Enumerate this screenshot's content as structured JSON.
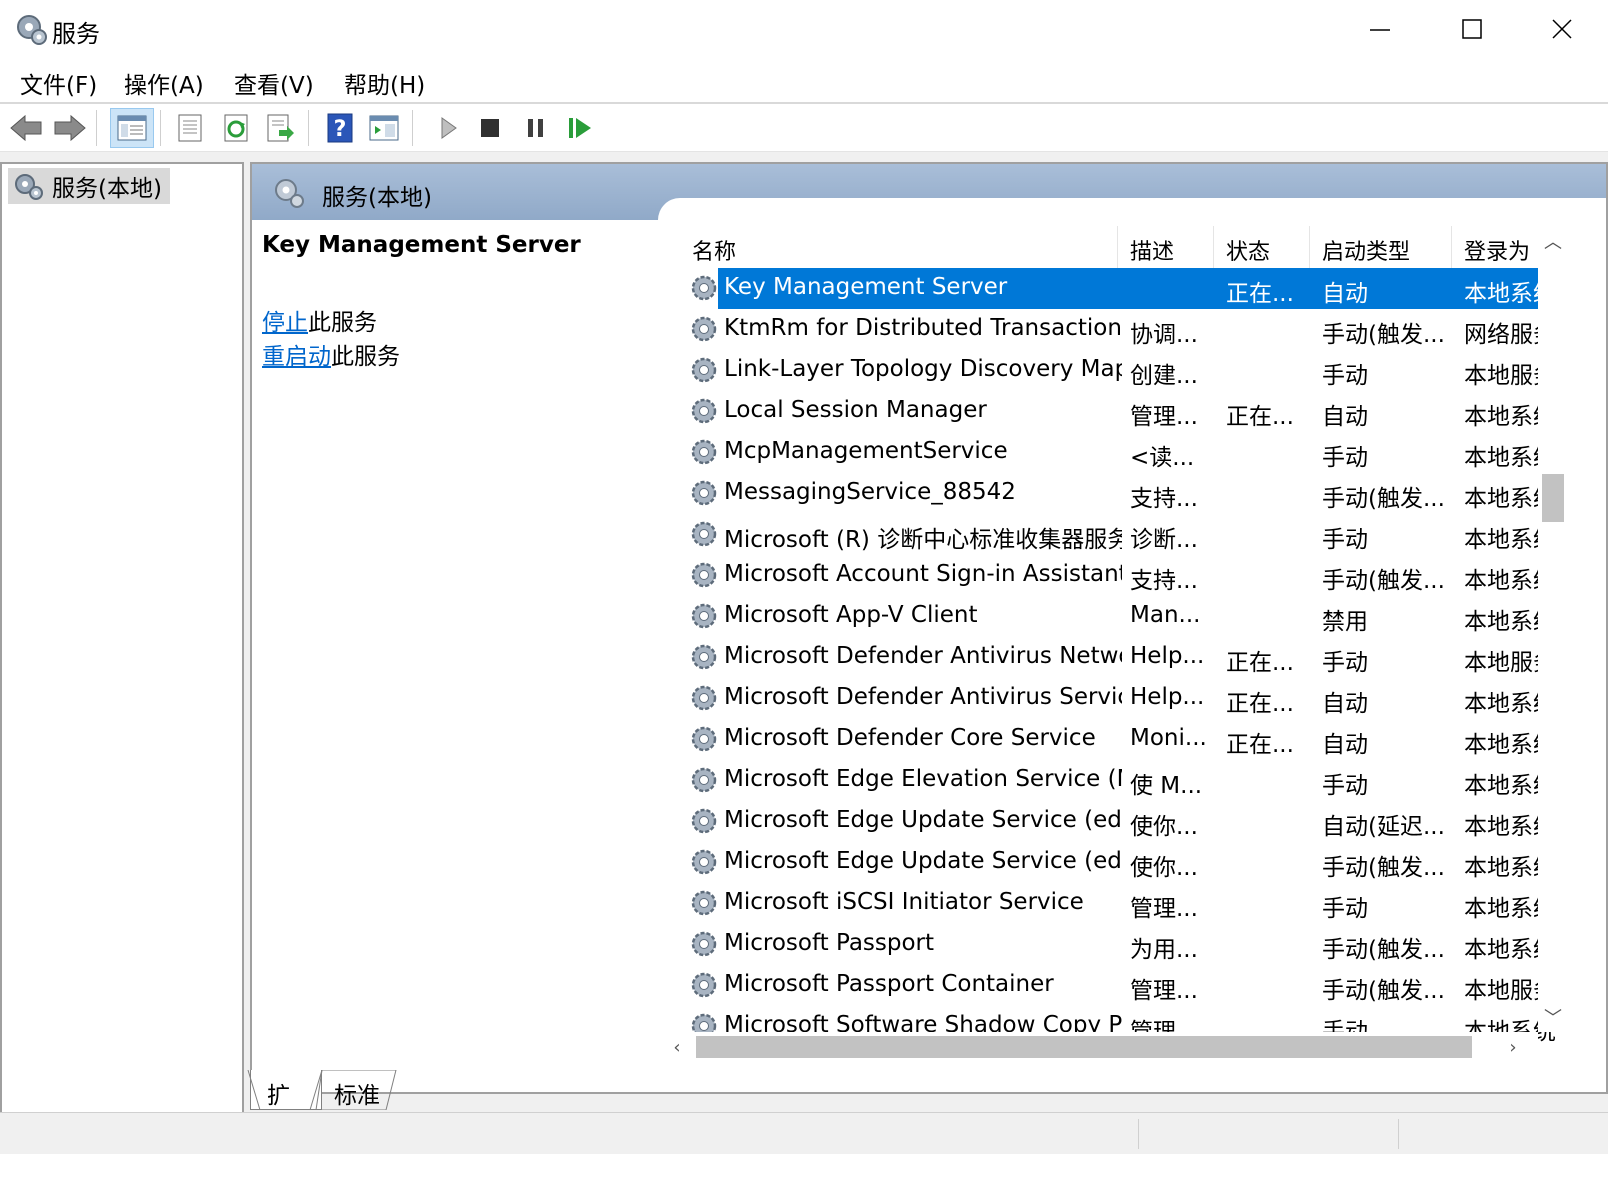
{
  "window": {
    "title": "服务",
    "app_icon": "gear-icon"
  },
  "menu": [
    {
      "label": "文件(F)"
    },
    {
      "label": "操作(A)"
    },
    {
      "label": "查看(V)"
    },
    {
      "label": "帮助(H)"
    }
  ],
  "toolbar": {
    "buttons": [
      "back-arrow-icon",
      "forward-arrow-icon",
      "console-tree-icon",
      "properties-icon",
      "refresh-icon",
      "export-list-icon",
      "help-icon",
      "view-icon",
      "play-icon",
      "stop-icon",
      "pause-icon",
      "resume-icon"
    ]
  },
  "tree": {
    "root_label": "服务(本地)"
  },
  "content": {
    "header_title": "服务(本地)",
    "selected_service_name": "Key Management Server",
    "stop_link": "停止",
    "stop_suffix": "此服务",
    "restart_link": "重启动",
    "restart_suffix": "此服务"
  },
  "list": {
    "columns": [
      "名称",
      "描述",
      "状态",
      "启动类型",
      "登录为"
    ],
    "rows": [
      {
        "name": "Key Management Server",
        "desc": "",
        "status": "正在...",
        "startup": "自动",
        "logon": "本地系统",
        "selected": true
      },
      {
        "name": "KtmRm for Distributed Transaction ...",
        "desc": "协调...",
        "status": "",
        "startup": "手动(触发...",
        "logon": "网络服务"
      },
      {
        "name": "Link-Layer Topology Discovery Map...",
        "desc": "创建...",
        "status": "",
        "startup": "手动",
        "logon": "本地服务"
      },
      {
        "name": "Local Session Manager",
        "desc": "管理...",
        "status": "正在...",
        "startup": "自动",
        "logon": "本地系统"
      },
      {
        "name": "McpManagementService",
        "desc": "<读...",
        "status": "",
        "startup": "手动",
        "logon": "本地系统"
      },
      {
        "name": "MessagingService_88542",
        "desc": "支持...",
        "status": "",
        "startup": "手动(触发...",
        "logon": "本地系统"
      },
      {
        "name": "Microsoft (R) 诊断中心标准收集器服务",
        "desc": "诊断...",
        "status": "",
        "startup": "手动",
        "logon": "本地系统"
      },
      {
        "name": "Microsoft Account Sign-in Assistant",
        "desc": "支持...",
        "status": "",
        "startup": "手动(触发...",
        "logon": "本地系统"
      },
      {
        "name": "Microsoft App-V Client",
        "desc": "Man...",
        "status": "",
        "startup": "禁用",
        "logon": "本地系统"
      },
      {
        "name": "Microsoft Defender Antivirus Netwo...",
        "desc": "Help...",
        "status": "正在...",
        "startup": "手动",
        "logon": "本地服务"
      },
      {
        "name": "Microsoft Defender Antivirus Service",
        "desc": "Help...",
        "status": "正在...",
        "startup": "自动",
        "logon": "本地系统"
      },
      {
        "name": "Microsoft Defender Core Service",
        "desc": "Moni...",
        "status": "正在...",
        "startup": "自动",
        "logon": "本地系统"
      },
      {
        "name": "Microsoft Edge Elevation Service (M...",
        "desc": "使 M...",
        "status": "",
        "startup": "手动",
        "logon": "本地系统"
      },
      {
        "name": "Microsoft Edge Update Service (edg...",
        "desc": "使你...",
        "status": "",
        "startup": "自动(延迟...",
        "logon": "本地系统"
      },
      {
        "name": "Microsoft Edge Update Service (edg...",
        "desc": "使你...",
        "status": "",
        "startup": "手动(触发...",
        "logon": "本地系统"
      },
      {
        "name": "Microsoft iSCSI Initiator Service",
        "desc": "管理...",
        "status": "",
        "startup": "手动",
        "logon": "本地系统"
      },
      {
        "name": "Microsoft Passport",
        "desc": "为用...",
        "status": "",
        "startup": "手动(触发...",
        "logon": "本地系统"
      },
      {
        "name": "Microsoft Passport Container",
        "desc": "管理...",
        "status": "",
        "startup": "手动(触发...",
        "logon": "本地服务"
      },
      {
        "name": "Microsoft Software Shadow Copy Pr...",
        "desc": "管理...",
        "status": "",
        "startup": "手动",
        "logon": "本地系统"
      }
    ]
  },
  "tabs": [
    "扩展",
    "标准"
  ],
  "colors": {
    "selection": "#0078d7",
    "link": "#0066cc",
    "header_gradient_top": "#a9bed8",
    "header_gradient_bottom": "#90a9c8"
  }
}
